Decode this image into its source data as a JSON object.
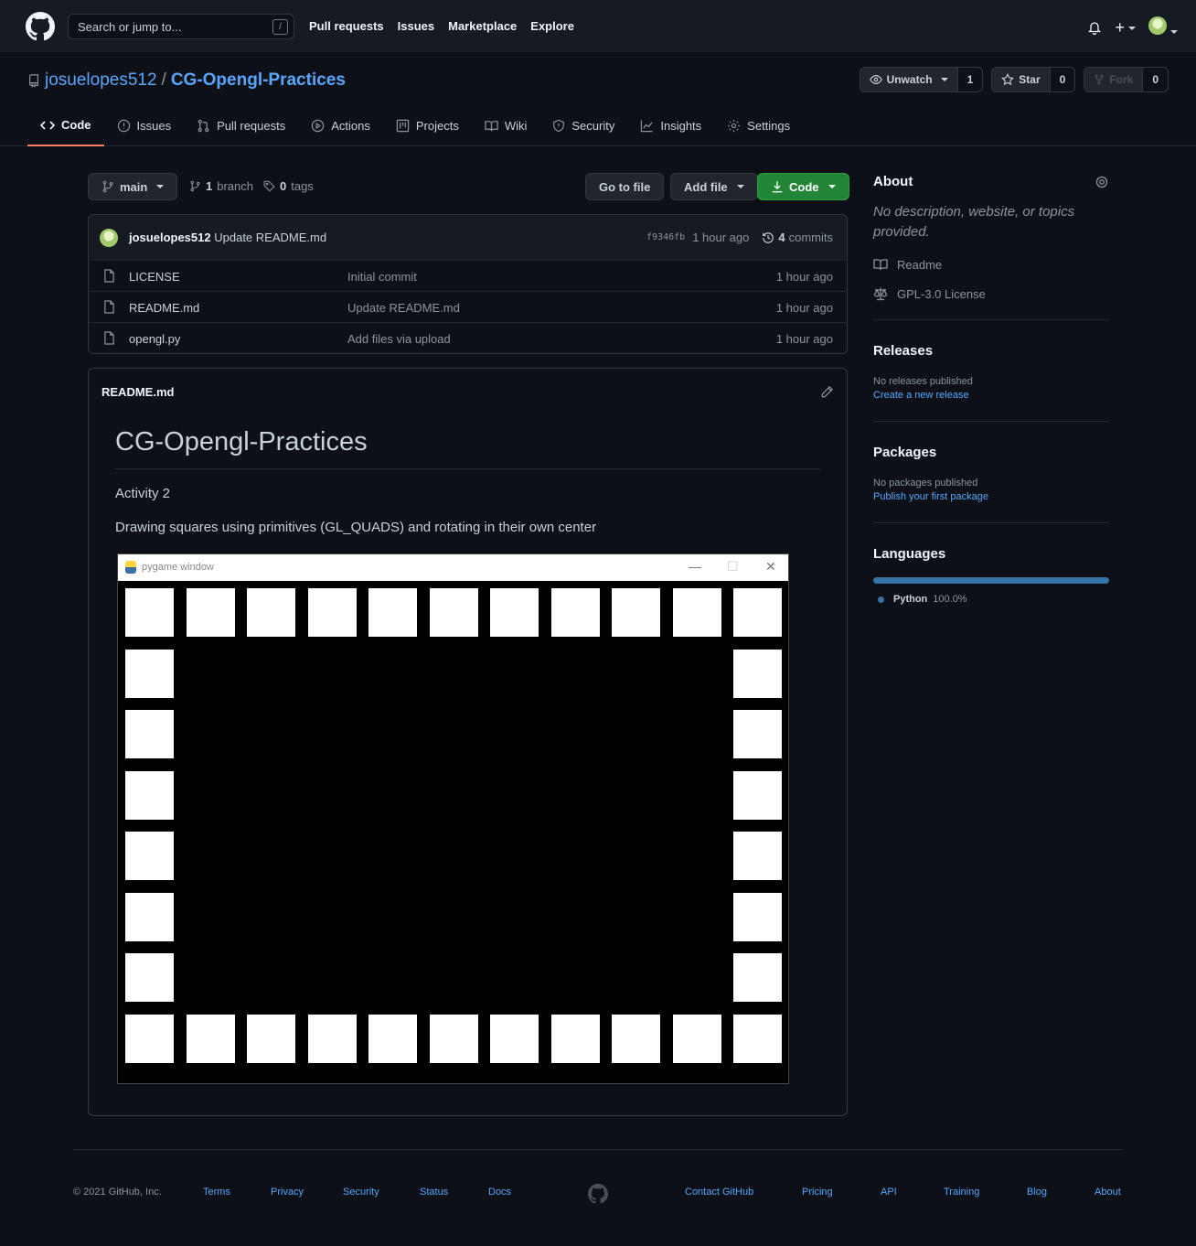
{
  "header": {
    "search_placeholder": "Search or jump to...",
    "search_key": "/",
    "nav": [
      "Pull requests",
      "Issues",
      "Marketplace",
      "Explore"
    ]
  },
  "repo": {
    "owner": "josuelopes512",
    "separator": "/",
    "name": "CG-Opengl-Practices",
    "watch_label": "Unwatch",
    "watch_count": "1",
    "star_label": "Star",
    "star_count": "0",
    "fork_label": "Fork",
    "fork_count": "0"
  },
  "tabs": [
    "Code",
    "Issues",
    "Pull requests",
    "Actions",
    "Projects",
    "Wiki",
    "Security",
    "Insights",
    "Settings"
  ],
  "toolbar": {
    "branch": "main",
    "branch_count": "1",
    "branch_word": "branch",
    "tag_count": "0",
    "tag_word": "tags",
    "go_to_file": "Go to file",
    "add_file": "Add file",
    "code": "Code"
  },
  "latest_commit": {
    "author": "josuelopes512",
    "message": "Update README.md",
    "sha": "f9346fb",
    "age": "1 hour ago",
    "commit_count": "4",
    "commit_word": "commits"
  },
  "files": [
    {
      "name": "LICENSE",
      "message": "Initial commit",
      "age": "1 hour ago"
    },
    {
      "name": "README.md",
      "message": "Update README.md",
      "age": "1 hour ago"
    },
    {
      "name": "opengl.py",
      "message": "Add files via upload",
      "age": "1 hour ago"
    }
  ],
  "readme": {
    "filename": "README.md",
    "heading": "CG-Opengl-Practices",
    "para1": "Activity 2",
    "para2": "Drawing squares using primitives (GL_QUADS) and rotating in their own center",
    "window_title": "pygame window"
  },
  "about": {
    "title": "About",
    "description": "No description, website, or topics provided.",
    "readme_link": "Readme",
    "license_link": "GPL-3.0 License"
  },
  "releases": {
    "title": "Releases",
    "empty": "No releases published",
    "link": "Create a new release"
  },
  "packages": {
    "title": "Packages",
    "empty": "No packages published",
    "link": "Publish your first package"
  },
  "languages": {
    "title": "Languages",
    "items": [
      {
        "name": "Python",
        "percent": "100.0%",
        "color": "#3572a5"
      }
    ]
  },
  "footer": {
    "copyright": "© 2021 GitHub, Inc.",
    "left_links": [
      "Terms",
      "Privacy",
      "Security",
      "Status",
      "Docs"
    ],
    "right_links": [
      "Contact GitHub",
      "Pricing",
      "API",
      "Training",
      "Blog",
      "About"
    ]
  },
  "colors": {
    "background": "#0d1117",
    "header": "#161b22",
    "link": "#58a6ff",
    "green_button": "#238636",
    "tab_underline": "#f78166"
  }
}
